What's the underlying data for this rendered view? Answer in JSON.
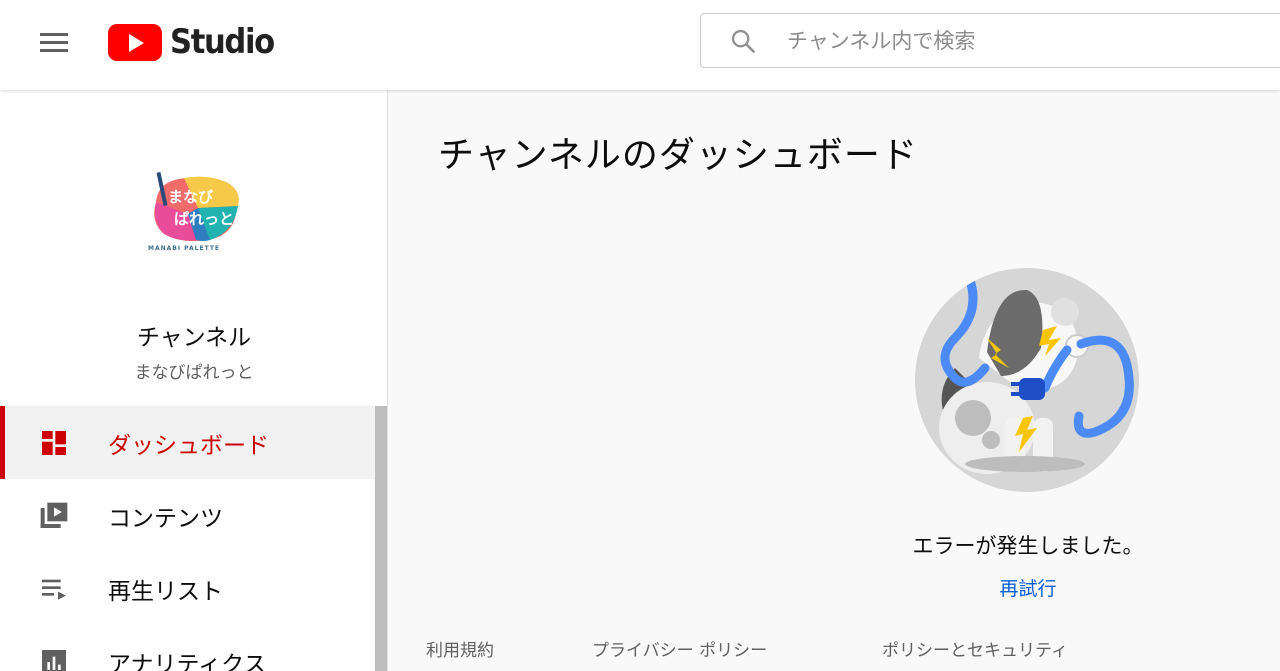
{
  "header": {
    "logo_text": "Studio",
    "search_placeholder": "チャンネル内で検索"
  },
  "sidebar": {
    "avatar_caption": "MANABI PALETTE",
    "avatar_text_line1": "まなび",
    "avatar_text_line2": "ぱれっと",
    "channel_label": "チャンネル",
    "channel_name": "まなびぱれっと",
    "items": [
      {
        "label": "ダッシュボード",
        "icon": "dashboard-icon",
        "active": true
      },
      {
        "label": "コンテンツ",
        "icon": "content-icon",
        "active": false
      },
      {
        "label": "再生リスト",
        "icon": "playlist-icon",
        "active": false
      },
      {
        "label": "アナリティクス",
        "icon": "analytics-icon",
        "active": false
      }
    ]
  },
  "main": {
    "title": "チャンネルのダッシュボード",
    "error_message": "エラーが発生しました。",
    "retry_label": "再試行"
  },
  "footer": {
    "links": [
      "利用規約",
      "プライバシー ポリシー",
      "ポリシーとセキュリティ"
    ]
  },
  "colors": {
    "accent": "#cc0000",
    "link": "#065fd4",
    "brand_red": "#ff0000"
  }
}
